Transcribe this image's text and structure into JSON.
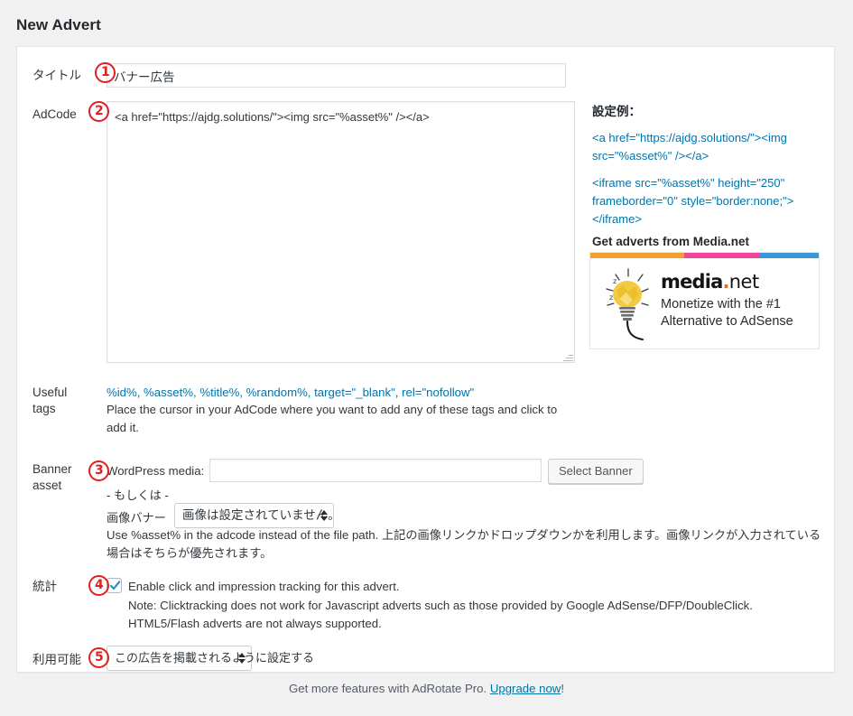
{
  "page": {
    "title": "New Advert"
  },
  "fields": {
    "title": {
      "label": "タイトル",
      "annotation": "1",
      "value": "バナー広告",
      "placeholder": ""
    },
    "adcode": {
      "label": "AdCode",
      "annotation": "2",
      "value": "<a href=\"https://ajdg.solutions/\"><img src=\"%asset%\" /></a>",
      "placeholder": ""
    },
    "useful_tags": {
      "label_line1": "Useful",
      "label_line2": "tags",
      "tags": "%id%, %asset%, %title%, %random%, target=\"_blank\", rel=\"nofollow\"",
      "help": "Place the cursor in your AdCode where you want to add any of these tags and click to add it."
    },
    "banner_asset": {
      "label_line1": "Banner",
      "label_line2": "asset",
      "annotation": "3",
      "wp_media_label": "WordPress media:",
      "wp_media_value": "",
      "wp_media_placeholder": "",
      "select_banner_button": "Select Banner",
      "or_text": "- もしくは -",
      "image_banner_label": "画像バナー",
      "image_banner_selected": "画像は設定されていません。",
      "help": "Use %asset% in the adcode instead of the file path. 上記の画像リンクかドロップダウンかを利用します。画像リンクが入力されている場合はそちらが優先されます。"
    },
    "statistics": {
      "label": "統計",
      "annotation": "4",
      "checkbox_checked": true,
      "checkbox_label": "Enable click and impression tracking for this advert.",
      "note_line1": "Note: Clicktracking does not work for Javascript adverts such as those provided by Google AdSense/DFP/DoubleClick.",
      "note_line2": "HTML5/Flash adverts are not always supported."
    },
    "availability": {
      "label": "利用可能",
      "annotation": "5",
      "selected": "この広告を掲載されるように設定する"
    }
  },
  "sidebar": {
    "heading": "設定例：",
    "example1_line1": "<a href=\"https://ajdg.solutions/\"><img",
    "example1_line2": "src=\"%asset%\" /></a>",
    "example2_line1": "<iframe src=\"%asset%\" height=\"250\"",
    "example2_line2": "frameborder=\"0\" style=\"border:none;\">",
    "example2_line3": "</iframe>",
    "media_heading": "Get adverts from Media.net",
    "banner": {
      "logo_media": "media",
      "logo_dot": ".",
      "logo_net": "net",
      "tagline_line1": "Monetize with the #1",
      "tagline_line2": "Alternative to AdSense",
      "stripe_colors": [
        "#f0a02c",
        "#f0469b",
        "#3b96d4"
      ]
    }
  },
  "footer": {
    "text_before": "Get more features with AdRotate Pro. ",
    "link": "Upgrade now",
    "text_after": "!"
  },
  "colors": {
    "link": "#0073aa",
    "annotation_red": "#e02020",
    "panel_bg": "#ffffff",
    "page_bg": "#f1f1f1"
  }
}
